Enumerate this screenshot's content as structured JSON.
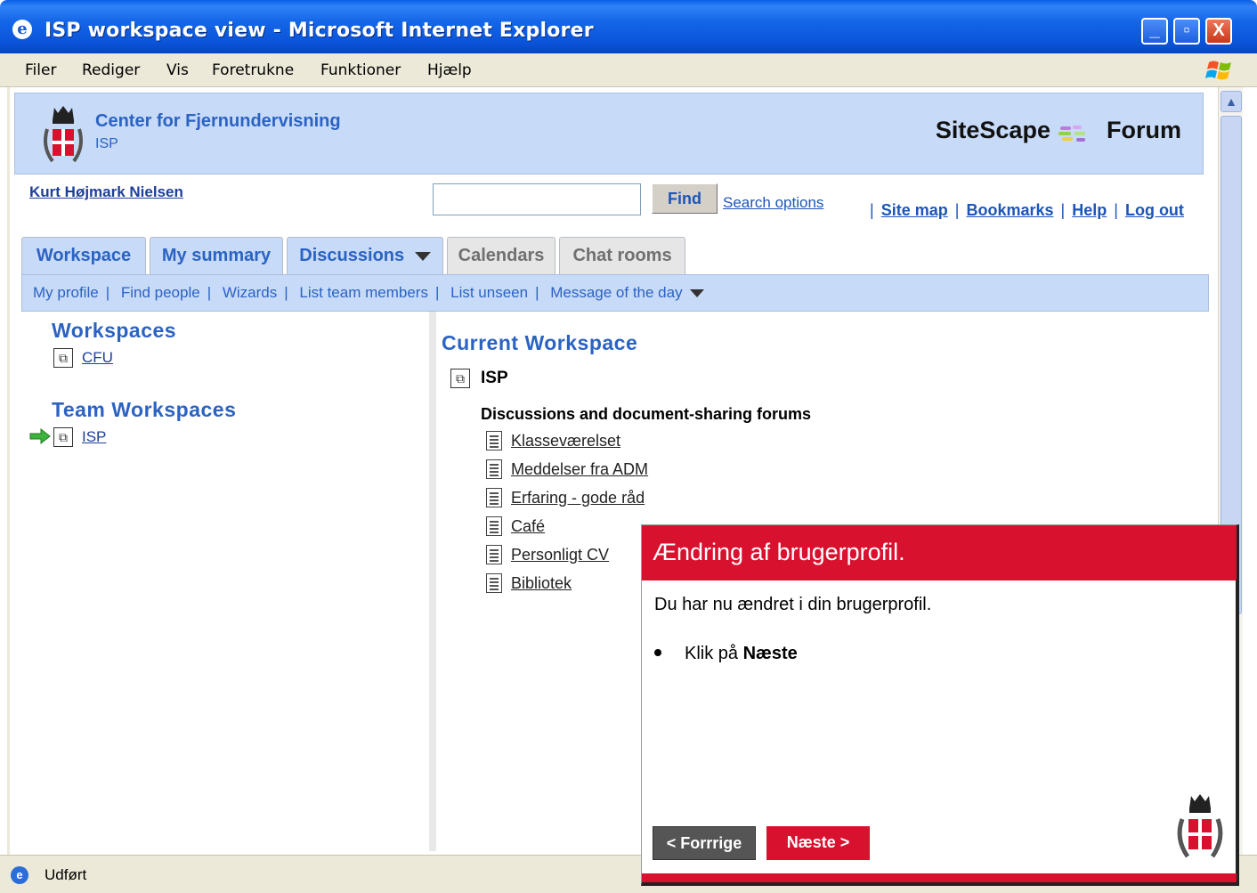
{
  "window": {
    "title": "ISP workspace view - Microsoft Internet Explorer",
    "min_symbol": "_",
    "max_symbol": "▫",
    "close_symbol": "X"
  },
  "menubar": {
    "items": [
      "Filer",
      "Rediger",
      "Vis",
      "Foretrukne",
      "Funktioner",
      "Hjælp"
    ]
  },
  "header": {
    "org_name": "Center for Fjernundervisning",
    "org_sub": "ISP",
    "brand_left": "SiteScape",
    "brand_right": "Forum"
  },
  "user": {
    "name": "Kurt Højmark Nielsen"
  },
  "search": {
    "value": "",
    "button": "Find",
    "options_link": "Search options"
  },
  "toplinks": [
    "Site map",
    "Bookmarks",
    "Help",
    "Log out"
  ],
  "tabs": [
    {
      "label": "Workspace"
    },
    {
      "label": "My summary"
    },
    {
      "label": "Discussions"
    },
    {
      "label": "Calendars"
    },
    {
      "label": "Chat rooms"
    }
  ],
  "subnav": [
    "My profile",
    "Find people",
    "Wizards",
    "List team members",
    "List unseen",
    "Message of the day"
  ],
  "left": {
    "workspaces_title": "Workspaces",
    "workspaces": [
      "CFU"
    ],
    "team_title": "Team Workspaces",
    "team_workspaces": [
      "ISP"
    ]
  },
  "current": {
    "title": "Current Workspace",
    "name": "ISP",
    "forums_heading": "Discussions and document-sharing forums",
    "forums": [
      "Klasseværelset",
      "Meddelser fra ADM",
      "Erfaring - gode råd",
      "Café",
      "Personligt CV",
      "Bibliotek"
    ]
  },
  "status": {
    "text": "Udført"
  },
  "overlay": {
    "title": "Ændring af brugerprofil.",
    "body": "Du har nu ændret i din brugerprofil.",
    "bullet_prefix": "Klik på ",
    "bullet_bold": "Næste",
    "prev_button": "< Forrrige",
    "next_button": "Næste >"
  },
  "colors": {
    "brand_blue": "#2b63c3",
    "header_bg": "#c7daf7",
    "overlay_red": "#d8112f"
  }
}
